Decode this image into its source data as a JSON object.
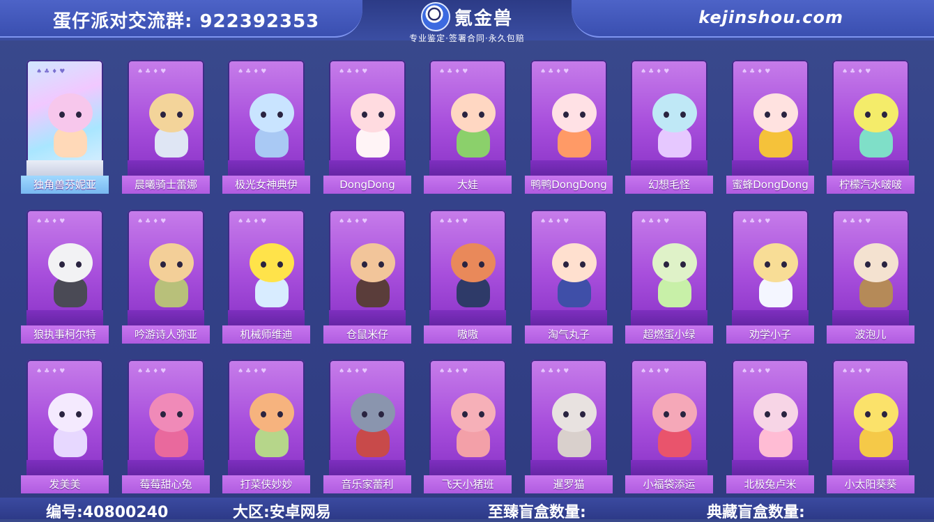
{
  "header": {
    "group_text": "蛋仔派对交流群:  922392353",
    "logo_name": "氪金兽",
    "logo_slogan": "专业鉴定·签署合同·永久包赔",
    "site_url": "kejinshou.com"
  },
  "card_suits": "♠♣♦♥",
  "characters": [
    {
      "name": "独角兽芬妮亚",
      "holo": true,
      "c1": "#f7c7ec",
      "c2": "#ffd9b8"
    },
    {
      "name": "晨曦骑士蕾娜",
      "c1": "#f3d49a",
      "c2": "#dfe6f4"
    },
    {
      "name": "极光女神典伊",
      "c1": "#c9e4ff",
      "c2": "#a9c9f4"
    },
    {
      "name": "DongDong",
      "c1": "#ffdbe0",
      "c2": "#fff4f6"
    },
    {
      "name": "大娃",
      "c1": "#ffd7c2",
      "c2": "#8bd06b"
    },
    {
      "name": "鸭鸭DongDong",
      "c1": "#ffe1e5",
      "c2": "#ff9a66"
    },
    {
      "name": "幻想毛怪",
      "c1": "#bfe8f6",
      "c2": "#e6c8ff"
    },
    {
      "name": "蜜蜂DongDong",
      "c1": "#ffe2e0",
      "c2": "#f5c23a"
    },
    {
      "name": "柠檬汽水啵啵",
      "c1": "#f4ec6a",
      "c2": "#7fdfc8"
    },
    {
      "name": "狼执事柯尔特",
      "c1": "#f2f2f4",
      "c2": "#4a4a55"
    },
    {
      "name": "吟游诗人弥亚",
      "c1": "#f3cf98",
      "c2": "#b8c07a"
    },
    {
      "name": "机械师维迪",
      "c1": "#ffe34a",
      "c2": "#d8ecff"
    },
    {
      "name": "仓鼠米仔",
      "c1": "#f2c59a",
      "c2": "#5a3d3a"
    },
    {
      "name": "嗷嗷",
      "c1": "#e9895a",
      "c2": "#2e3a68"
    },
    {
      "name": "淘气丸子",
      "c1": "#ffe0cf",
      "c2": "#3f4fa8"
    },
    {
      "name": "超燃蛋小绿",
      "c1": "#dff2c8",
      "c2": "#c8f0a8"
    },
    {
      "name": "劝学小子",
      "c1": "#f8dd96",
      "c2": "#f4f6ff"
    },
    {
      "name": "波泡儿",
      "c1": "#f4e2d0",
      "c2": "#b58a58"
    },
    {
      "name": "发美美",
      "c1": "#f4eafe",
      "c2": "#e7d8ff"
    },
    {
      "name": "莓莓甜心兔",
      "c1": "#f08ab8",
      "c2": "#e9699d"
    },
    {
      "name": "打菜侠妙妙",
      "c1": "#f6b37e",
      "c2": "#b6d68a"
    },
    {
      "name": "音乐家蕾利",
      "c1": "#8a95ae",
      "c2": "#c84a4a"
    },
    {
      "name": "飞天小猪班",
      "c1": "#f6b0b8",
      "c2": "#f3a0a8"
    },
    {
      "name": "暹罗猫",
      "c1": "#e8e2e0",
      "c2": "#d9d0cc"
    },
    {
      "name": "小福袋添运",
      "c1": "#f5a8b8",
      "c2": "#e9546c"
    },
    {
      "name": "北极兔卢米",
      "c1": "#f7d5e6",
      "c2": "#ffbcd4"
    },
    {
      "name": "小太阳葵葵",
      "c1": "#fbe26a",
      "c2": "#f5c948"
    }
  ],
  "footer": {
    "id_text": "编号:40800240",
    "region_text": "大区:安卓网易",
    "supreme_text": "至臻盲盒数量:",
    "collection_text": "典藏盲盒数量:"
  }
}
